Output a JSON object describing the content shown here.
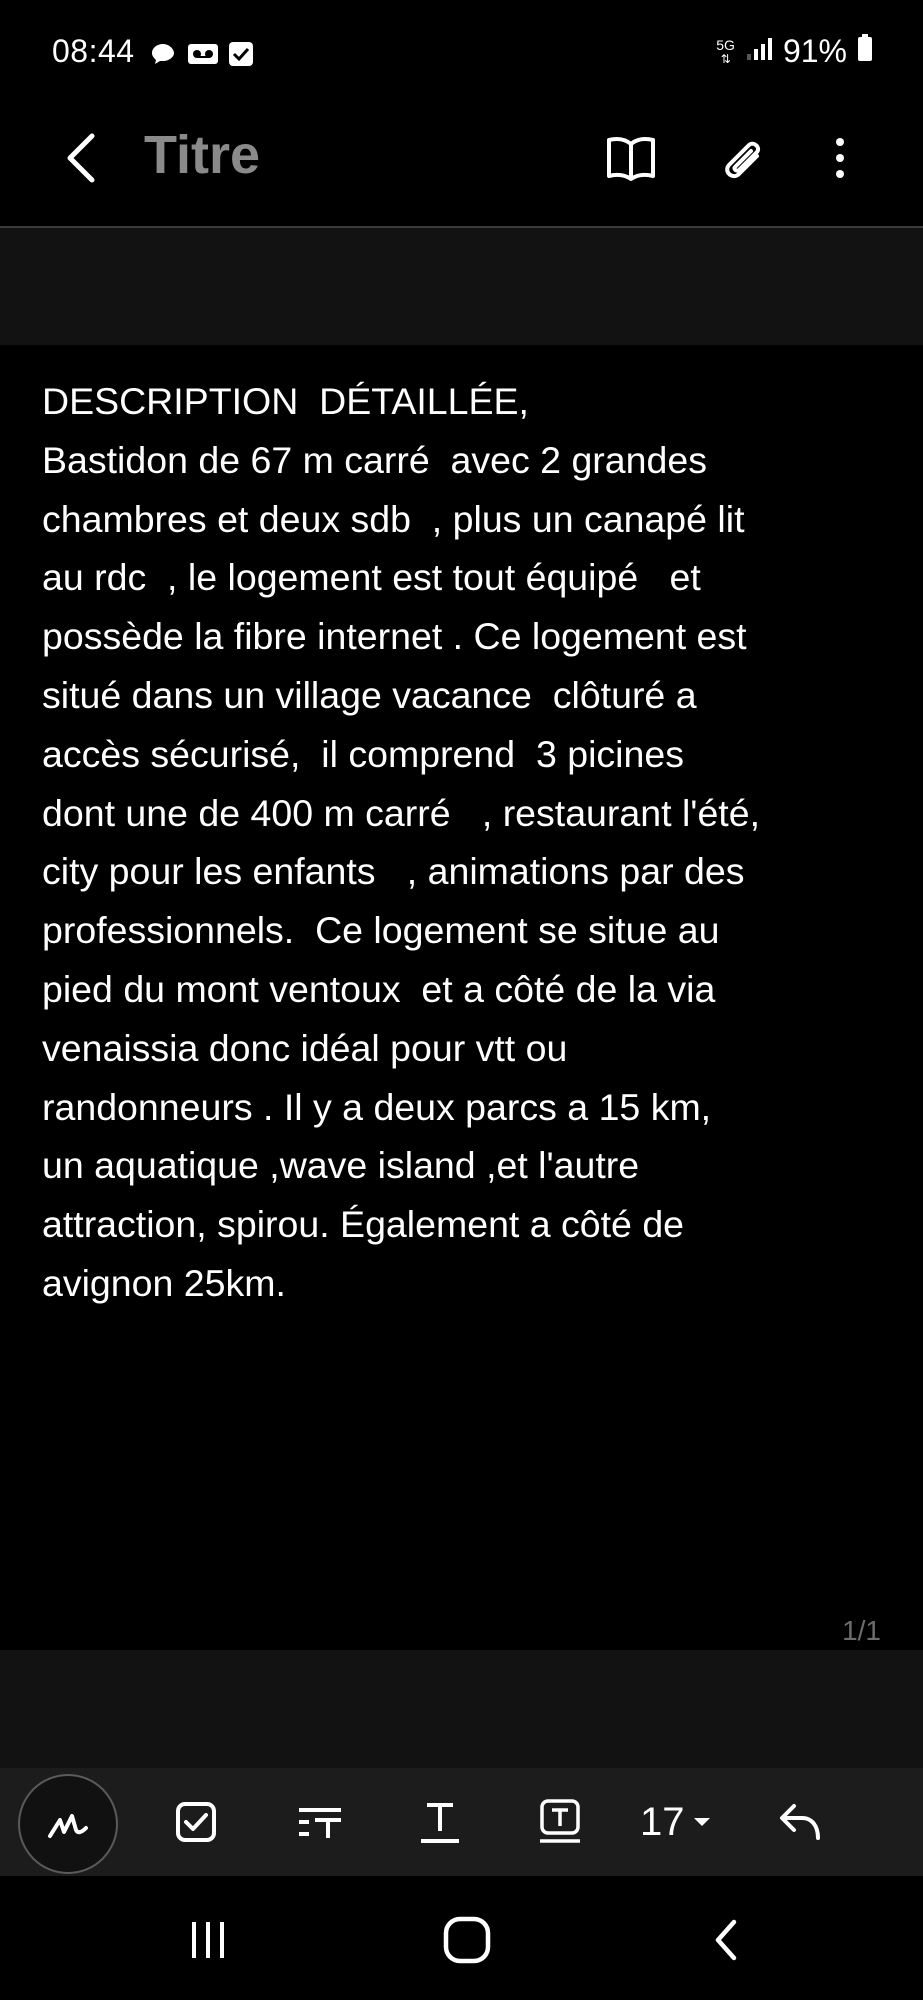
{
  "status_bar": {
    "time": "08:44",
    "network": "5G",
    "battery": "91%"
  },
  "header": {
    "title": "Titre"
  },
  "note": {
    "lines": [
      "DESCRIPTION  DÉTAILLÉE,",
      "Bastidon de 67 m carré  avec 2 grandes",
      "chambres et deux sdb  , plus un canapé lit",
      "au rdc  , le logement est tout équipé   et",
      "possède la fibre internet . Ce logement est",
      "situé dans un village vacance  clôturé a",
      "accès sécurisé,  il comprend  3 picines",
      "dont une de 400 m carré   , restaurant l'été,",
      "city pour les enfants   , animations par des",
      "professionnels.  Ce logement se situe au",
      "pied du mont ventoux  et a côté de la via",
      "venaissia donc idéal pour vtt ou",
      "randonneurs . Il y a deux parcs a 15 km,",
      "un aquatique ,wave island ,et l'autre",
      "attraction, spirou. Également a côté de",
      "avignon 25km."
    ],
    "page_indicator": "1/1"
  },
  "toolbar": {
    "font_size": "17"
  },
  "colors": {
    "background": "#000000",
    "title_gray": "#8a8a8a",
    "band_gray": "#121212",
    "toolbar_bg": "#1c1c1c"
  }
}
